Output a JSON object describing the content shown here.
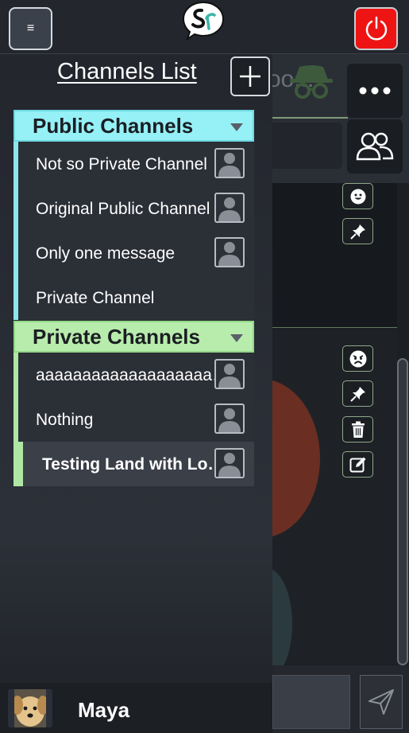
{
  "topbar": {
    "menu_icon": "≡",
    "logo_text": "Sr",
    "power_icon": "power-icon"
  },
  "chat": {
    "channel_name_peek": "oo..."
  },
  "drawer": {
    "title": "Channels List",
    "add_icon": "plus-icon",
    "public_section": {
      "label": "Public Channels",
      "items": [
        {
          "label": "Not so Private Channel"
        },
        {
          "label": "Original Public Channel"
        },
        {
          "label": "Only one message"
        },
        {
          "label": "Private Channel"
        }
      ]
    },
    "private_section": {
      "label": "Private Channels",
      "items": [
        {
          "label": "aaaaaaaaaaaaaaaaaaaaaaaaaaaaaa"
        },
        {
          "label": "Nothing"
        },
        {
          "label": "Testing Land with Lorem"
        }
      ]
    }
  },
  "user": {
    "name": "Maya"
  },
  "colors": {
    "public_accent": "#95f1f6",
    "private_accent": "#b8ecac",
    "power_red": "#ee1414"
  }
}
